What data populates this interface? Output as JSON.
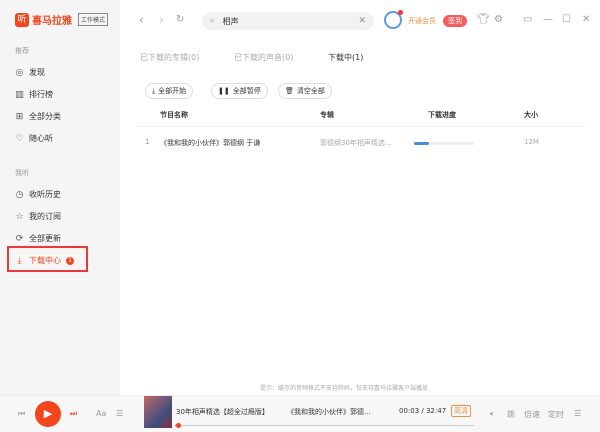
{
  "app": {
    "logo_text": "喜马拉雅",
    "mode_label": "工作模式"
  },
  "sidebar": {
    "section1": "推荐",
    "items1": [
      {
        "label": "发现",
        "icon": "compass-icon"
      },
      {
        "label": "排行榜",
        "icon": "chart-icon"
      },
      {
        "label": "全部分类",
        "icon": "grid-icon"
      },
      {
        "label": "随心听",
        "icon": "heart-icon"
      }
    ],
    "section2": "我听",
    "items2": [
      {
        "label": "收听历史",
        "icon": "clock-icon"
      },
      {
        "label": "我的订阅",
        "icon": "star-icon"
      },
      {
        "label": "全部更新",
        "icon": "refresh-icon"
      },
      {
        "label": "下载中心",
        "icon": "download-icon",
        "badge": "1"
      }
    ]
  },
  "topbar": {
    "search_value": "相声",
    "vip_label": "开通会员",
    "sign_label": "签到"
  },
  "tabs": [
    {
      "label": "已下载的专辑(0)"
    },
    {
      "label": "已下载的声音(0)"
    },
    {
      "label": "下载中(1)",
      "active": true
    }
  ],
  "actions": {
    "start_all": "全部开始",
    "pause_all": "全部暂停",
    "clear_all": "清空全部"
  },
  "table": {
    "headers": [
      "节目名称",
      "专辑",
      "下载进度",
      "大小"
    ],
    "rows": [
      {
        "index": "1",
        "title": "《我和我的小伙伴》郭德纲 于谦",
        "album": "郭德纲30年相声精选...",
        "progress": 0.25,
        "size": "12M"
      }
    ]
  },
  "hint": "提示：缓存的音频格式不支持转码，仅支持喜马拉雅客户端播放",
  "player": {
    "album_title": "30年相声精选【超全过瘾版】",
    "track_title": "《我和我的小伙伴》郭德...",
    "time": "00:03 / 32:47",
    "quality": "高清",
    "skip_label": "跳",
    "speed_label": "倍速",
    "timer_label": "定时",
    "position": 0.002
  },
  "colors": {
    "brand": "#f3461d",
    "progress": "#4a8be0"
  }
}
